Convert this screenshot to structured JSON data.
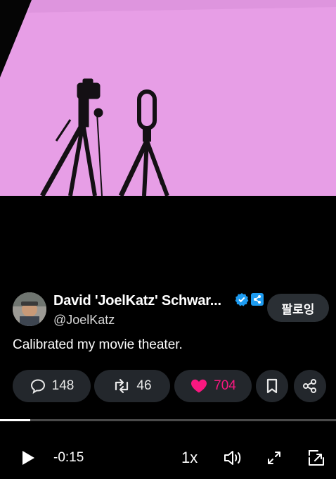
{
  "tweet": {
    "author_name": "David 'JoelKatz' Schwar...",
    "handle": "@JoelKatz",
    "follow_label": "팔로잉",
    "text": "Calibrated my movie theater."
  },
  "stats": {
    "replies": "148",
    "reposts": "46",
    "likes": "704"
  },
  "player": {
    "time_remaining": "-0:15",
    "speed": "1x",
    "progress": 0.09
  },
  "colors": {
    "screen_pink": "#e79ee6",
    "like_pink": "#f91880",
    "verified_blue": "#1d9bf0",
    "background": "#000000"
  },
  "icons": [
    "reply-icon",
    "repost-icon",
    "heart-icon",
    "bookmark-icon",
    "share-icon",
    "play-icon",
    "volume-icon",
    "fullscreen-icon",
    "minimize-icon",
    "verified-icon",
    "affiliate-icon"
  ]
}
